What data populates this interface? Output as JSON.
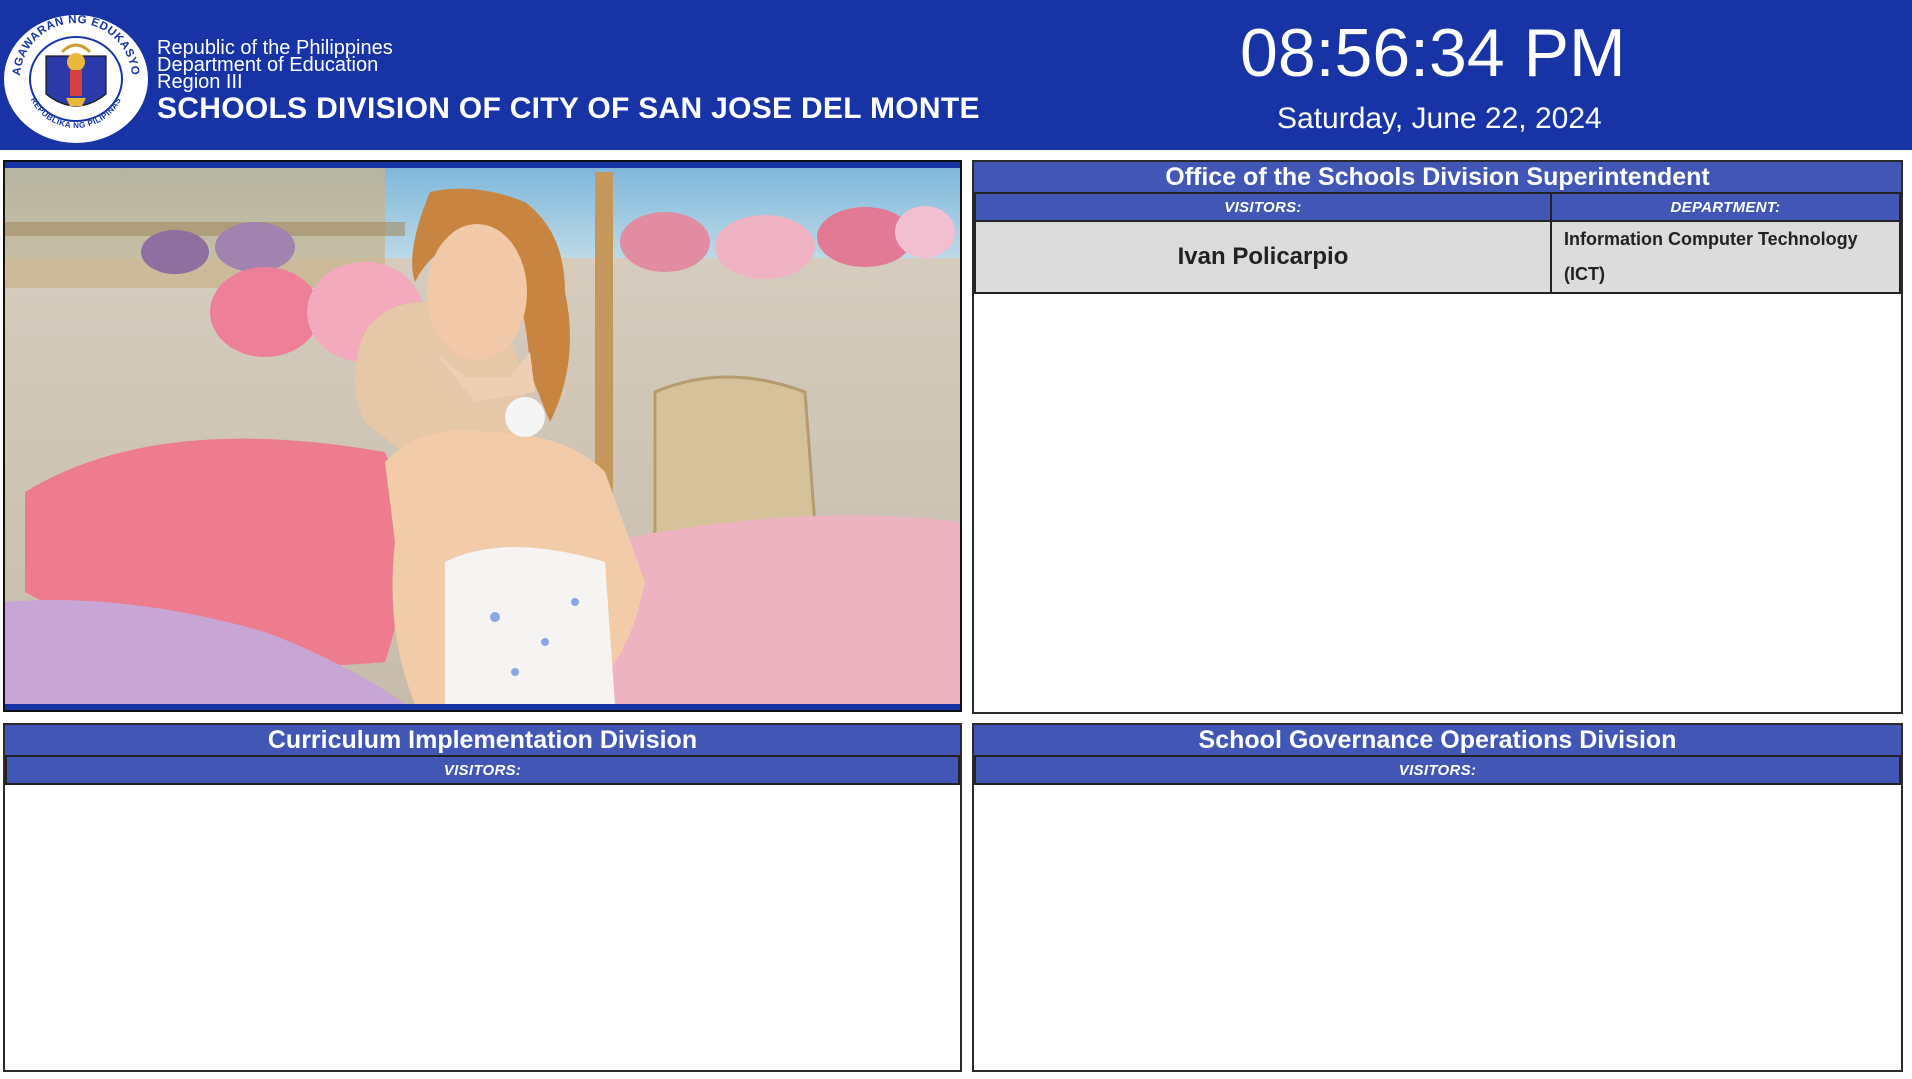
{
  "header": {
    "seal": {
      "icon": "deped-seal-icon",
      "top_text": "KAGAWARAN NG EDUKASYON",
      "bottom_text": "REPUBLIKA NG PILIPINAS"
    },
    "line1": "Republic of the Philippines",
    "line2": "Department of Education",
    "line3": "Region III",
    "division_title": "SCHOOLS DIVISION OF CITY OF SAN JOSE DEL MONTE",
    "time": "08:56:34 PM",
    "date": "Saturday, June 22, 2024"
  },
  "colors": {
    "header_bg": "#1733a6",
    "panel_header_bg": "#4257b5",
    "visitor_row_bg": "#dcdcdc"
  },
  "panels": {
    "osds": {
      "title": "Office of the Schools Division Superintendent",
      "visitors_label": "VISITORS:",
      "department_label": "DEPARTMENT:",
      "rows": [
        {
          "visitor": "Ivan Policarpio",
          "department": "Information Computer Technology (ICT)"
        }
      ]
    },
    "cid": {
      "title": "Curriculum Implementation Division",
      "visitors_label": "VISITORS:"
    },
    "sgod": {
      "title": "School Governance Operations Division",
      "visitors_label": "VISITORS:"
    }
  }
}
